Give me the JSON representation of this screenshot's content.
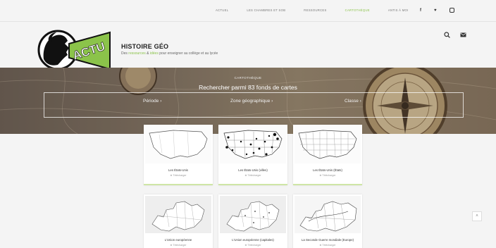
{
  "topnav": {
    "links": [
      "ACTUEL",
      "LES CHAMBRES ET SOB",
      "RESSOURCES",
      "CARTOTHÈQUE",
      "ANTIS À MOI"
    ],
    "active_index": 3,
    "social": [
      "f",
      "♥"
    ]
  },
  "brand": {
    "logo_text": "ACTU",
    "title": "HISTOIRE GÉO",
    "tagline_pre": "Des ",
    "tagline_g1": "ressources",
    "tagline_mid": " & ",
    "tagline_g2": "idées",
    "tagline_post": " pour enseigner au collège et au lycée"
  },
  "hero": {
    "kicker": "CARTOTHÈQUE",
    "headline": "Rechercher parmi 83 fonds de cartes",
    "filter_period": "Période  ›",
    "filter_zone": "Zone géographique  ›",
    "filter_class": "Classe  ›"
  },
  "cards": [
    {
      "title": "Les États-Unis",
      "meta": "⊕ Télécharger"
    },
    {
      "title": "Les États-Unis (villes)",
      "meta": "⊕ Télécharger"
    },
    {
      "title": "Les États-Unis (États)",
      "meta": "⊕ Télécharger"
    },
    {
      "title": "L'Union européenne",
      "meta": "⊕ Télécharger"
    },
    {
      "title": "L'Union européenne (capitales)",
      "meta": "⊕ Télécharger"
    },
    {
      "title": "La Seconde Guerre mondiale (Europe)",
      "meta": "⊕ Télécharger"
    }
  ],
  "colors": {
    "accent": "#8bc34a",
    "hero_dark": "#6e6257",
    "card_border": "#cfe6a6"
  }
}
